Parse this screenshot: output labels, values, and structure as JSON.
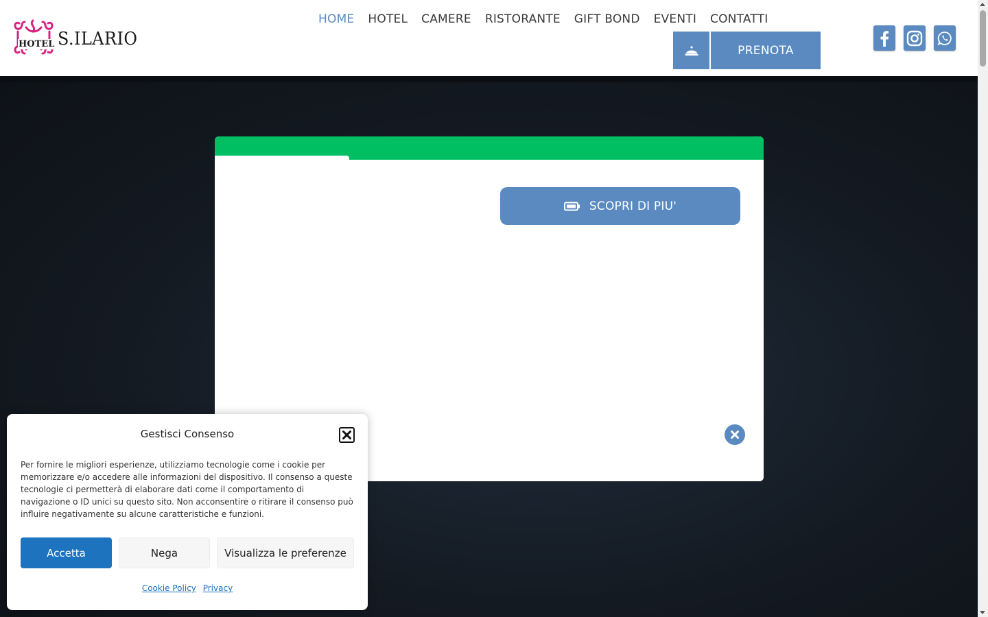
{
  "header": {
    "logo": {
      "prefix": "HOTEL",
      "name": "S.ILARIO"
    },
    "nav": [
      {
        "label": "HOME",
        "active": true
      },
      {
        "label": "HOTEL"
      },
      {
        "label": "CAMERE"
      },
      {
        "label": "RISTORANTE"
      },
      {
        "label": "GIFT BOND"
      },
      {
        "label": "EVENTI"
      },
      {
        "label": "CONTATTI"
      }
    ],
    "book_button": {
      "label": "PRENOTA",
      "icon": "service-bell-icon"
    },
    "social": [
      {
        "name": "facebook",
        "icon": "facebook-icon"
      },
      {
        "name": "instagram",
        "icon": "instagram-icon"
      },
      {
        "name": "whatsapp",
        "icon": "whatsapp-icon"
      }
    ]
  },
  "popup": {
    "band_color": "#00bf63",
    "discover_button": {
      "label": "SCOPRI DI PIU'",
      "icon": "battery-icon"
    },
    "close_icon": "close-circle-icon"
  },
  "consent": {
    "title": "Gestisci Consenso",
    "text": "Per fornire le migliori esperienze, utilizziamo tecnologie come i cookie per memorizzare e/o accedere alle informazioni del dispositivo. Il consenso a queste tecnologie ci permetterà di elaborare dati come il comportamento di navigazione o ID unici su questo sito. Non acconsentire o ritirare il consenso può influire negativamente su alcune caratteristiche e funzioni.",
    "buttons": {
      "accept": "Accetta",
      "deny": "Nega",
      "preferences": "Visualizza le preferenze"
    },
    "links": {
      "cookie_policy": "Cookie Policy",
      "privacy": "Privacy"
    }
  },
  "colors": {
    "accent": "#5a8abf",
    "consent_primary": "#1e73be",
    "logo_pink": "#d6247f"
  }
}
